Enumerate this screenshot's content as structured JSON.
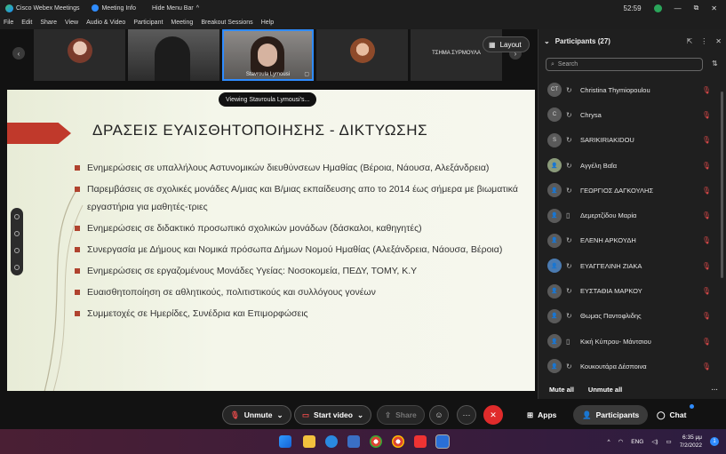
{
  "titlebar": {
    "app_name": "Cisco Webex Meetings",
    "meeting_info": "Meeting Info",
    "hide_menu_bar": "Hide Menu Bar",
    "timer": "52:59",
    "minimize": "—",
    "restore": "⧉",
    "close": "✕"
  },
  "menu": [
    "File",
    "Edit",
    "Share",
    "View",
    "Audio & Video",
    "Participant",
    "Meeting",
    "Breakout Sessions",
    "Help"
  ],
  "video_strip": {
    "tiles": [
      {
        "label": ""
      },
      {
        "label": ""
      },
      {
        "label": "Stavroula Lymousi"
      },
      {
        "label": ""
      },
      {
        "label": "ΤΣΗΜΑ ΣΥΡΜΟΥΛΑ"
      }
    ],
    "layout_label": "Layout"
  },
  "viewing_label": "Viewing Stavroula Lymousi's...",
  "slide": {
    "title": "ΔΡΑΣΕΙΣ  ΕΥΑΙΣΘΗΤΟΠΟΙΗΣΗΣ - ΔΙΚΤΥΩΣΗΣ",
    "bullets": [
      "Ενημερώσεις σε υπαλλήλους  Αστυνομικών διευθύνσεων Ημαθίας (Βέροια, Νάουσα, Αλεξάνδρεια)",
      "Παρεμβάσεις σε σχολικές μονάδες Α/μιας και Β/μιας εκπαίδευσης απο το 2014 έως σήμερα με βιωματικά εργαστήρια για μαθητές-τριες",
      "Ενημερώσεις σε διδακτικό προσωπικό σχολικών μονάδων (δάσκαλοι, καθηγητές)",
      "Συνεργασία με Δήμους και Νομικά πρόσωπα Δήμων Νομού Ημαθίας (Αλεξάνδρεια, Νάουσα, Βέροια)",
      "Ενημερώσεις σε εργαζομένους  Μονάδες Υγείας: Νοσοκομεία, ΠΕΔΥ, ΤΟΜΥ, Κ.Υ",
      "Ευαισθητοποίηση σε αθλητικούς, πολιτιστικούς  και συλλόγους γονέων",
      "Συμμετοχές σε Ημερίδες, Συνέδρια και Επιμορφώσεις"
    ]
  },
  "participants": {
    "header": "Participants (27)",
    "search_placeholder": "Search",
    "list": [
      {
        "initials": "CT",
        "name": "Christina Thymiopoulou"
      },
      {
        "initials": "C",
        "name": "Chrysa"
      },
      {
        "initials": "S",
        "name": "SARIKIRIAKIDOU"
      },
      {
        "initials": "",
        "name": "Αγγέλη Βαΐα"
      },
      {
        "initials": "",
        "name": "ΓΕΩΡΓΙΟΣ ΔΑΓΚΟΥΛΗΣ"
      },
      {
        "initials": "",
        "name": "Δεμερτζίδου Μαρία"
      },
      {
        "initials": "",
        "name": "ΕΛΕΝΗ ΑΡΚΟΥΔΗ"
      },
      {
        "initials": "",
        "name": "ΕΥΑΓΓΕΛΙΝΗ ΖΙΑΚΑ"
      },
      {
        "initials": "",
        "name": "ΕΥΣΤΑΘΙΑ ΜΑΡΚΟΥ"
      },
      {
        "initials": "",
        "name": "Θωμας Παντοφλιδης"
      },
      {
        "initials": "",
        "name": "Κική Κύπρου- Μάντσιου"
      },
      {
        "initials": "",
        "name": "Κουκουτάρα Δέσποινα"
      }
    ],
    "mute_all": "Mute all",
    "unmute_all": "Unmute all"
  },
  "controls": {
    "unmute": "Unmute",
    "start_video": "Start video",
    "share": "Share",
    "apps": "Apps",
    "participants": "Participants",
    "chat": "Chat"
  },
  "taskbar": {
    "lang": "ENG",
    "time": "6:35 μμ",
    "date": "7/2/2022",
    "notifications": "1"
  },
  "colors": {
    "accent_blue": "#2f8cff",
    "end_red": "#e02b2b",
    "slide_arrow": "#c0392b",
    "muted_mic": "#e34a4a"
  }
}
